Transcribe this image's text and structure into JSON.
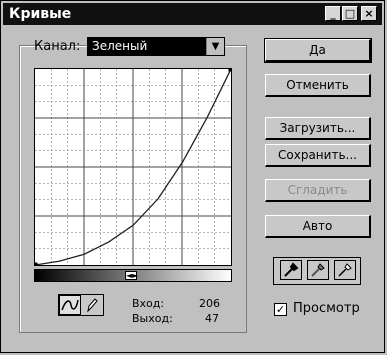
{
  "window": {
    "title": "Кривые",
    "controls": {
      "minimize": "_",
      "maximize": "□",
      "close": "×"
    }
  },
  "channel": {
    "label": "Канал:",
    "value": "Зеленый"
  },
  "buttons": {
    "ok": "Да",
    "cancel": "Отменить",
    "load": "Загрузить...",
    "save": "Сохранить...",
    "smooth": "Сгладить",
    "auto": "Авто"
  },
  "readout": {
    "input_label": "Вход:",
    "input_value": "206",
    "output_label": "Выход:",
    "output_value": "47"
  },
  "preview": {
    "label": "Просмотр",
    "checked": true
  },
  "gradient_marker": "◄►",
  "icons": {
    "curve_tool": "curve-icon",
    "pencil_tool": "pencil-icon",
    "eyedropper_black": "eyedropper-black-icon",
    "eyedropper_gray": "eyedropper-gray-icon",
    "eyedropper_white": "eyedropper-white-icon"
  },
  "chart_data": {
    "type": "line",
    "xlim": [
      0,
      255
    ],
    "ylim": [
      0,
      255
    ],
    "grid": true,
    "series": [
      {
        "points": [
          [
            0,
            0
          ],
          [
            32,
            5
          ],
          [
            64,
            14
          ],
          [
            96,
            30
          ],
          [
            128,
            52
          ],
          [
            160,
            86
          ],
          [
            192,
            134
          ],
          [
            224,
            192
          ],
          [
            255,
            255
          ]
        ]
      }
    ]
  }
}
